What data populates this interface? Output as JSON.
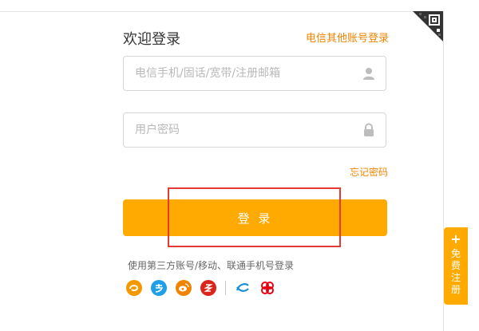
{
  "header": {
    "title": "欢迎登录",
    "other_account_link": "电信其他账号登录"
  },
  "form": {
    "username": {
      "value": "",
      "placeholder": "电信手机/固话/宽带/注册邮箱",
      "icon": "user-icon"
    },
    "password": {
      "value": "",
      "placeholder": "用户密码",
      "icon": "lock-icon"
    },
    "forgot_link": "忘记密码",
    "login_button": "登 录"
  },
  "third_party": {
    "label": "使用第三方账号/移动、联通手机号登录",
    "providers": [
      {
        "icon": "tianyi-icon",
        "color": "#f39800"
      },
      {
        "icon": "alipay-icon",
        "color": "#1e9fe8"
      },
      {
        "icon": "weibo-icon",
        "color": "#f08300"
      },
      {
        "icon": "red-provider-icon",
        "color": "#d9251c"
      },
      {
        "icon": "china-mobile-icon",
        "color": "#1a8fd6"
      },
      {
        "icon": "china-unicom-icon",
        "color": "#e60012"
      }
    ]
  },
  "side_tab": {
    "plus": "+",
    "label": "免费注册"
  },
  "colors": {
    "accent": "#ffaa00",
    "link": "#f08300",
    "highlight": "#e53935"
  }
}
